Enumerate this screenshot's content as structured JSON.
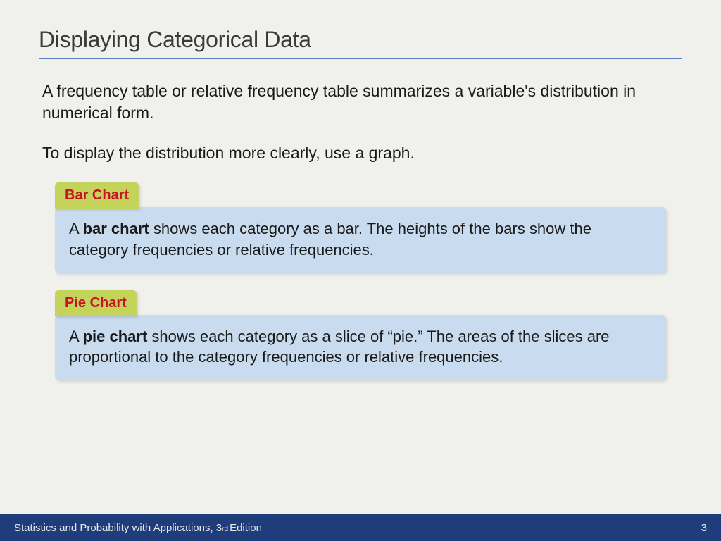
{
  "title": "Displaying Categorical Data",
  "intro1": "A frequency table or relative frequency table summarizes a variable's distribution in numerical form.",
  "intro2": "To display the distribution more clearly, use a graph.",
  "callouts": [
    {
      "label": "Bar Chart",
      "prefix": "A ",
      "bold": "bar chart",
      "rest": " shows each category as a bar. The heights of the bars show the category frequencies or relative frequencies."
    },
    {
      "label": "Pie Chart",
      "prefix": "A ",
      "bold": "pie chart",
      "rest": " shows each category as a slice of “pie.” The areas of the slices are proportional to the category frequencies or relative frequencies."
    }
  ],
  "footer": {
    "book_pre": "Statistics and Probability with Applications, 3",
    "ord": "rd",
    "book_post": " Edition",
    "page": "3"
  }
}
